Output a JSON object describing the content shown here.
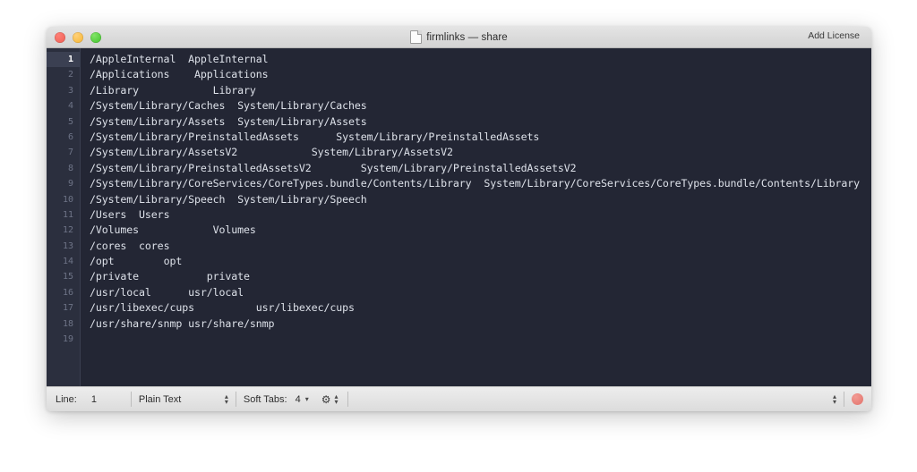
{
  "window": {
    "traffic_lights": [
      {
        "name": "close",
        "color": "#ec5c51"
      },
      {
        "name": "minimize",
        "color": "#f5b32e"
      },
      {
        "name": "zoom",
        "color": "#3ec229"
      }
    ],
    "title": "firmlinks — share",
    "doc_icon": "document-icon",
    "toolbar_right_label": "Add License"
  },
  "editor": {
    "background": "#232634",
    "gutter_background": "#2b2f3e",
    "text_color": "#dde1e9",
    "current_line": 1,
    "lines": [
      {
        "n": "1",
        "text": "/AppleInternal\tAppleInternal"
      },
      {
        "n": "2",
        "text": "/Applications\t Applications"
      },
      {
        "n": "3",
        "text": "/Library\t    Library"
      },
      {
        "n": "4",
        "text": "/System/Library/Caches\tSystem/Library/Caches"
      },
      {
        "n": "5",
        "text": "/System/Library/Assets\tSystem/Library/Assets"
      },
      {
        "n": "6",
        "text": "/System/Library/PreinstalledAssets\tSystem/Library/PreinstalledAssets"
      },
      {
        "n": "7",
        "text": "/System/Library/AssetsV2\t    System/Library/AssetsV2"
      },
      {
        "n": "8",
        "text": "/System/Library/PreinstalledAssetsV2\t    System/Library/PreinstalledAssetsV2"
      },
      {
        "n": "9",
        "text": "/System/Library/CoreServices/CoreTypes.bundle/Contents/Library\tSystem/Library/CoreServices/CoreTypes.bundle/Contents/Library"
      },
      {
        "n": "10",
        "text": "/System/Library/Speech\tSystem/Library/Speech"
      },
      {
        "n": "11",
        "text": "/Users\tUsers"
      },
      {
        "n": "12",
        "text": "/Volumes\t    Volumes"
      },
      {
        "n": "13",
        "text": "/cores\tcores"
      },
      {
        "n": "14",
        "text": "/opt\t    opt"
      },
      {
        "n": "15",
        "text": "/private\t   private"
      },
      {
        "n": "16",
        "text": "/usr/local\tusr/local"
      },
      {
        "n": "17",
        "text": "/usr/libexec/cups\t   usr/libexec/cups"
      },
      {
        "n": "18",
        "text": "/usr/share/snmp usr/share/snmp"
      },
      {
        "n": "19",
        "text": ""
      }
    ]
  },
  "statusbar": {
    "line_label": "Line:",
    "line_value": "1",
    "syntax_value": "Plain Text",
    "soft_tabs_label": "Soft Tabs:",
    "soft_tabs_value": "4",
    "gear_icon": "gear-icon",
    "chevron_down_icon": "▾",
    "stepper_up": "▴",
    "stepper_down": "▾",
    "record_indicator": "record-dot",
    "record_color": "#e2736c"
  }
}
